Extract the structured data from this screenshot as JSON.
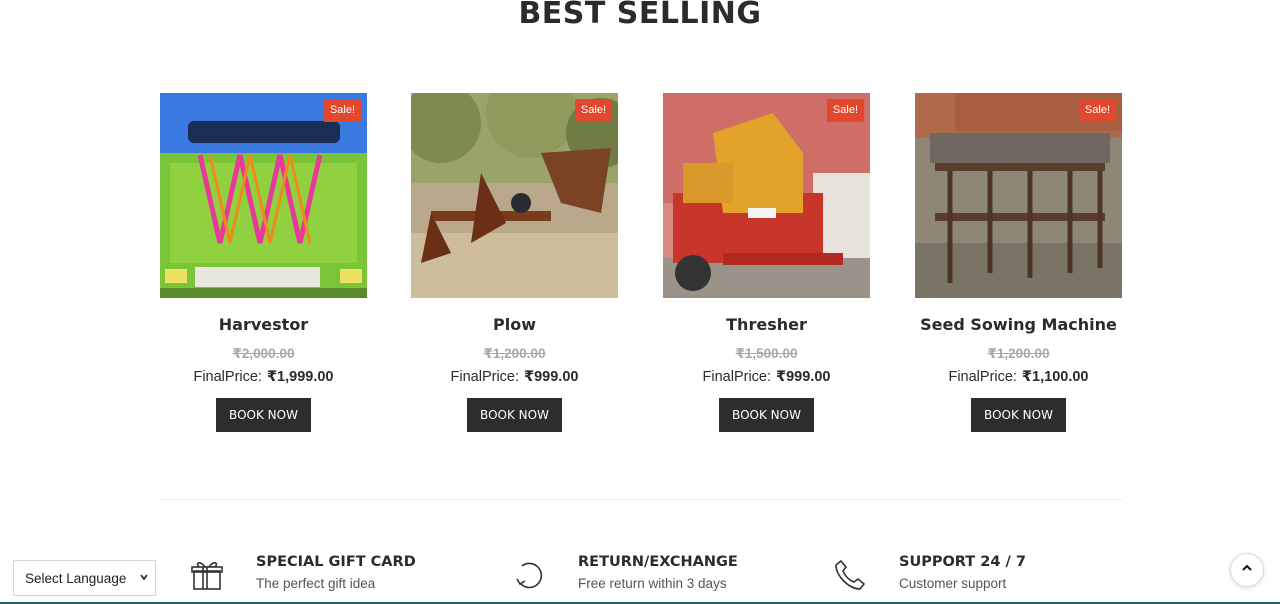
{
  "section": {
    "title": "BEST SELLING"
  },
  "products": [
    {
      "name": "Harvestor",
      "badge": "Sale!",
      "old_price": "₹2,000.00",
      "final_label": "FinalPrice:",
      "final_price": "₹1,999.00",
      "button": "BOOK NOW"
    },
    {
      "name": "Plow",
      "badge": "Sale!",
      "old_price": "₹1,200.00",
      "final_label": "FinalPrice:",
      "final_price": "₹999.00",
      "button": "BOOK NOW"
    },
    {
      "name": "Thresher",
      "badge": "Sale!",
      "old_price": "₹1,500.00",
      "final_label": "FinalPrice:",
      "final_price": "₹999.00",
      "button": "BOOK NOW"
    },
    {
      "name": "Seed Sowing Machine",
      "badge": "Sale!",
      "old_price": "₹1,200.00",
      "final_label": "FinalPrice:",
      "final_price": "₹1,100.00",
      "button": "BOOK NOW"
    }
  ],
  "features": [
    {
      "icon": "gift-icon",
      "title": "SPECIAL GIFT CARD",
      "subtitle": "The perfect gift idea"
    },
    {
      "icon": "return-icon",
      "title": "RETURN/EXCHANGE",
      "subtitle": "Free return within 3 days"
    },
    {
      "icon": "phone-icon",
      "title": "SUPPORT 24 / 7",
      "subtitle": "Customer support"
    }
  ],
  "language": {
    "selected": "Select Language"
  },
  "colors": {
    "sale": "#e3472d",
    "button": "#2d2d2d",
    "text": "#2b2b2b",
    "muted": "#a9a9a9"
  },
  "icons": {
    "scroll_top": "chevron-up-icon",
    "dropdown": "chevron-down-icon"
  }
}
